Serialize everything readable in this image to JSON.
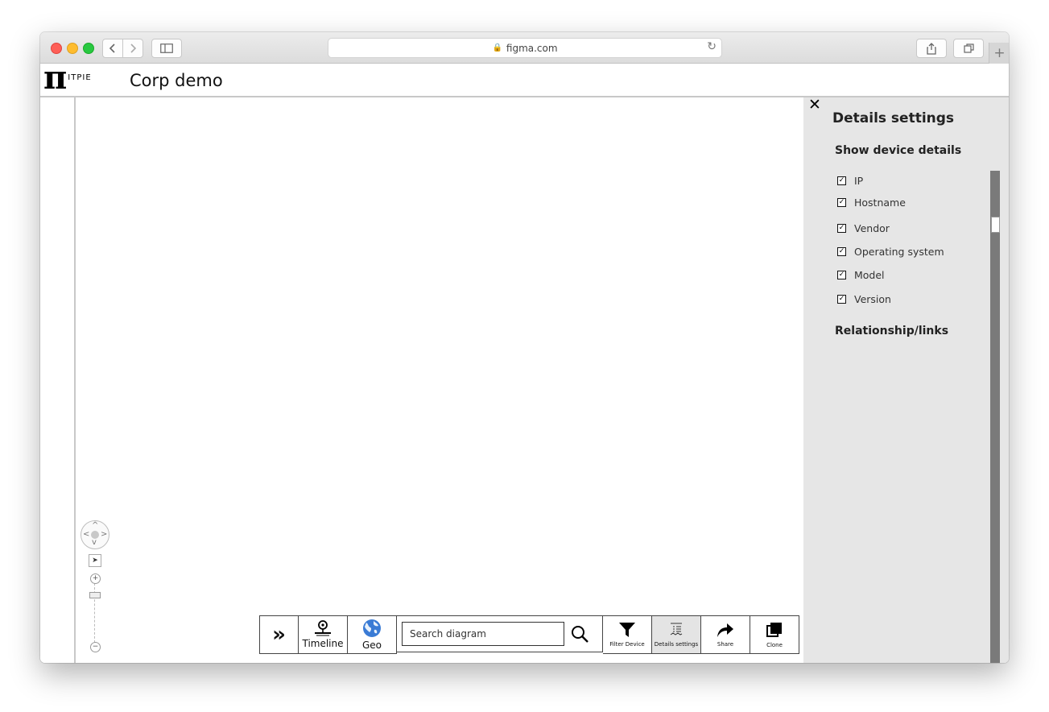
{
  "browser": {
    "url": "figma.com",
    "back_icon": "chevron-left-icon",
    "forward_icon": "chevron-right-icon",
    "new_tab_label": "+"
  },
  "app": {
    "logo_symbol": "π",
    "logo_text": "ITPIE",
    "title": "Corp demo"
  },
  "zoom": {
    "plus_label": "+",
    "minus_label": "−",
    "level": 0.8
  },
  "toolbar": {
    "expand_label": "»",
    "timeline_label": "Timeline",
    "geo_label": "Geo",
    "search_placeholder": "Search diagram",
    "filter_label": "Filter Device",
    "details_label": "Details settings",
    "share_label": "Share",
    "clone_label": "Clone"
  },
  "panel": {
    "close_label": "✕",
    "title": "Details settings",
    "device_section": "Show device details",
    "items": [
      {
        "label": "IP",
        "checked": true
      },
      {
        "label": "Hostname",
        "checked": true
      },
      {
        "label": "Vendor",
        "checked": true
      },
      {
        "label": "Operating system",
        "checked": true
      },
      {
        "label": "Model",
        "checked": true
      },
      {
        "label": "Version",
        "checked": true
      }
    ],
    "links_section": "Relationship/links"
  },
  "colors": {
    "panel_bg": "#e6e6e6",
    "scrollbar": "#7a7a7a",
    "active_button": "#e4e4e4"
  }
}
